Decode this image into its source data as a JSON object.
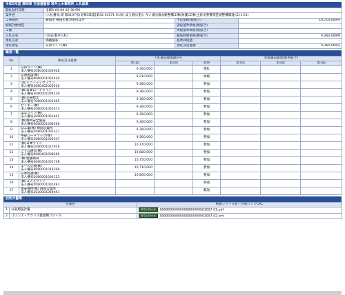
{
  "header": {
    "title": "令和5年度 静岡県 交通基盤部 袋井土木事務所 入札結果"
  },
  "info_rows": [
    {
      "label": "開札執行日時",
      "value": "令和5-09-09 02:38 PM",
      "right_label": "",
      "right_value": ""
    },
    {
      "label": "案件名",
      "value": "(入札番号:袋 第0107号)令和3年度[第32-S3571-01号] ぼう僧川支川 今ノ浦川排水路整備工事(防護)工事(土砂災害警戒区域整備関連)工(1-01)",
      "right_label": "",
      "right_value": ""
    },
    {
      "label": "工事箇所",
      "value": "磐田市  磐田市豊浜地内ほか",
      "right_label": "予定価格(税抜き)",
      "right_value": "10,710,000円"
    },
    {
      "label": "掘削対象地区",
      "value": "",
      "right_label": "調査基準価格(税抜き)",
      "right_value": "-"
    },
    {
      "label": "工種",
      "value": "",
      "right_label": "失格基準価格(税抜き)",
      "right_value": "-"
    },
    {
      "label": "入札方式",
      "value": "(方法:電子入札)",
      "right_label": "最低制限価格(税抜き)",
      "right_value": "9,360,000円"
    },
    {
      "label": "落札方式",
      "value": "価格競争",
      "right_label": "基準評価値",
      "right_value": "-"
    },
    {
      "label": "落札者名",
      "value": "日邦ライン(株)",
      "right_label": "落札決定金額",
      "right_value": "9,360,000円"
    }
  ],
  "bidders_section": {
    "title": "業者一覧",
    "col_no": "No",
    "col_name": "商号又は名称",
    "group_bid": "入札書記載金額(円)",
    "group_reason": "見積書記載金額(税抜き)",
    "round1": "第1回",
    "round2": "第2回",
    "round3": "第3回",
    "col_result": "結果"
  },
  "bidders": [
    {
      "no": "1",
      "name": "日邦ライン(株)",
      "corp": "法人番号5080401003928",
      "amount": "9,360,000",
      "result": "落札"
    },
    {
      "no": "2",
      "name": "交通施設(株)",
      "corp": "法人番号8080001001420",
      "amount": "9,210,000",
      "result": "失格"
    },
    {
      "no": "3",
      "name": "(有)トラフィックプラン",
      "corp": "法人番号4080402005610",
      "amount": "9,360,000",
      "result": "参加"
    },
    {
      "no": "4",
      "name": "(株)日本ロードライン",
      "corp": "法人番号3080001004139",
      "amount": "9,360,000",
      "result": "参加"
    },
    {
      "no": "5",
      "name": "(株)交研標示",
      "corp": "法人番号7080001001405",
      "amount": "9,360,000",
      "result": "参加"
    },
    {
      "no": "6",
      "name": "セイキー(株)",
      "corp": "法人番号2080001002473",
      "amount": "9,360,000",
      "result": "参加"
    },
    {
      "no": "7",
      "name": "山公ライン(株)",
      "corp": "法人番号3080001001641",
      "amount": "9,360,000",
      "result": "参加"
    },
    {
      "no": "8",
      "name": "(株)静岡安全施設",
      "corp": "法人番号6080001008368",
      "amount": "9,360,000",
      "result": "参加"
    },
    {
      "no": "9",
      "name": "日工業(株)  静岡営業所",
      "corp": "法人番号5080001002337",
      "amount": "9,360,000",
      "result": "参加"
    },
    {
      "no": "10",
      "name": "中部ロードテック(株)",
      "corp": "法人番号3080001003347",
      "amount": "9,360,000",
      "result": "参加"
    },
    {
      "no": "11",
      "name": "(株)日本ライン",
      "corp": "法人番号2080001017918",
      "amount": "10,170,000",
      "result": "参加"
    },
    {
      "no": "12",
      "name": "アトム通信(株)",
      "corp": "法人番号9080401008269",
      "amount": "10,680,000",
      "result": "参加"
    },
    {
      "no": "13",
      "name": "(株)佐藤興商",
      "corp": "法人番号4080401001738",
      "amount": "10,750,000",
      "result": "参加"
    },
    {
      "no": "14",
      "name": "エース交通(株)",
      "corp": "法人番号4080001016298",
      "amount": "10,710,000",
      "result": "参加"
    },
    {
      "no": "15",
      "name": "日本標識(株)",
      "corp": "法人番号2080001004123",
      "amount": "10,800,000",
      "result": "参加"
    },
    {
      "no": "16",
      "name": "(株)コスモライン",
      "corp": "法人番号5080001001497",
      "amount": "",
      "result": "辞退"
    },
    {
      "no": "17",
      "name": "保安機材(株)  静岡営業所",
      "corp": "法人番号2020001069493",
      "amount": "",
      "result": "無効"
    }
  ],
  "attachments_section": {
    "title": "別所文書等",
    "col_doc": "文書名",
    "col_file": "格納ファイル名／外部リンクURL",
    "download_label": "ダウンロード"
  },
  "attachments": [
    {
      "no": "1",
      "name": "公表用設計書",
      "file": "00000000000000000000001057-01.pdf"
    },
    {
      "no": "2",
      "name": "コリンズ・テクリス登録用ファイル",
      "file": "00000000000000000000001057-02.xml"
    }
  ]
}
